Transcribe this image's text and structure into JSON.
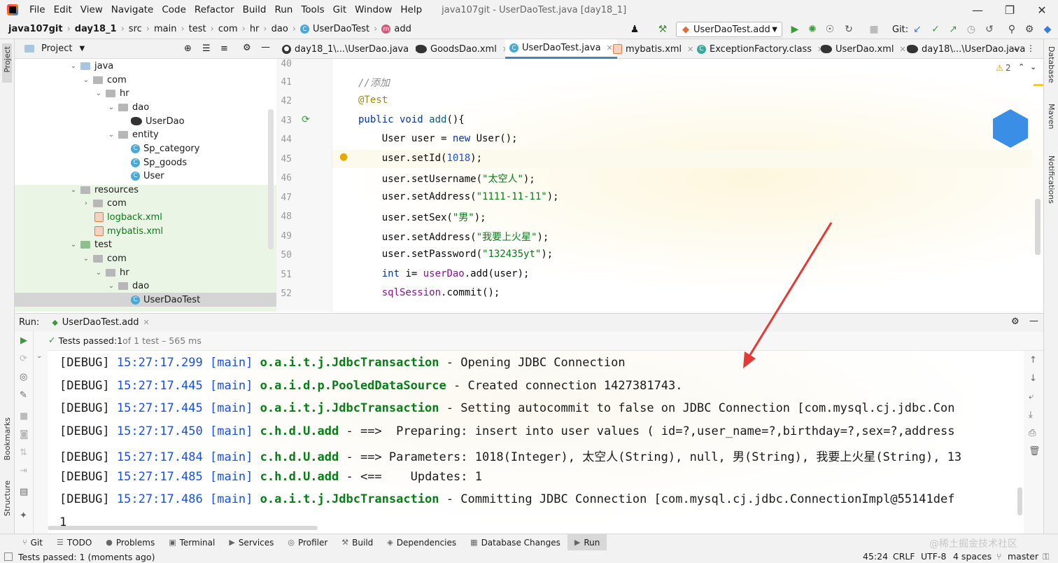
{
  "menu": {
    "items": [
      "File",
      "Edit",
      "View",
      "Navigate",
      "Code",
      "Refactor",
      "Build",
      "Run",
      "Tools",
      "Git",
      "Window",
      "Help"
    ],
    "title": "java107git - UserDaoTest.java [day18_1]"
  },
  "nav": {
    "crumbs": [
      "java107git",
      "day18_1",
      "src",
      "main",
      "test",
      "com",
      "hr",
      "dao",
      "UserDaoTest",
      "add"
    ],
    "run_config": "UserDaoTest.add",
    "git_label": "Git:"
  },
  "project": {
    "title": "Project",
    "tree": [
      {
        "label": "java",
        "level": 0,
        "type": "folder"
      },
      {
        "label": "com",
        "level": 1,
        "type": "folder"
      },
      {
        "label": "hr",
        "level": 2,
        "type": "folder"
      },
      {
        "label": "dao",
        "level": 3,
        "type": "folder"
      },
      {
        "label": "UserDao",
        "level": 4,
        "type": "bird"
      },
      {
        "label": "entity",
        "level": 3,
        "type": "folder"
      },
      {
        "label": "Sp_category",
        "level": 4,
        "type": "class"
      },
      {
        "label": "Sp_goods",
        "level": 4,
        "type": "class"
      },
      {
        "label": "User",
        "level": 4,
        "type": "class"
      },
      {
        "label": "resources",
        "level": 0,
        "type": "folder"
      },
      {
        "label": "com",
        "level": 1,
        "type": "folder"
      },
      {
        "label": "logback.xml",
        "level": 1,
        "type": "xml"
      },
      {
        "label": "mybatis.xml",
        "level": 1,
        "type": "xml"
      },
      {
        "label": "test",
        "level": 0,
        "type": "folder"
      },
      {
        "label": "com",
        "level": 1,
        "type": "folder"
      },
      {
        "label": "hr",
        "level": 2,
        "type": "folder"
      },
      {
        "label": "dao",
        "level": 3,
        "type": "folder"
      },
      {
        "label": "UserDaoTest",
        "level": 4,
        "type": "class"
      }
    ]
  },
  "tabs": [
    {
      "label": "day18_1\\...\\UserDao.java"
    },
    {
      "label": "GoodsDao.xml"
    },
    {
      "label": "UserDaoTest.java"
    },
    {
      "label": "mybatis.xml"
    },
    {
      "label": "ExceptionFactory.class"
    },
    {
      "label": "UserDao.xml"
    },
    {
      "label": "day18\\...\\UserDao.java"
    }
  ],
  "editor": {
    "warnings": "2",
    "line_numbers": [
      "40",
      "41",
      "42",
      "43",
      "44",
      "45",
      "46",
      "47",
      "48",
      "49",
      "50",
      "51",
      "52"
    ],
    "lines": {
      "l41": "//添加",
      "l42": "@Test",
      "l43a": "public void ",
      "l43b": "add",
      "l43c": "(){",
      "l44a": "    User user = ",
      "l44b": "new ",
      "l44c": "User();",
      "l45a": "    user.setId(",
      "l45b": "1018",
      "l45c": ");",
      "l46a": "    user.setUsername(",
      "l46b": "\"太空人\"",
      "l46c": ");",
      "l47a": "    user.setAddress(",
      "l47b": "\"1111-11-11\"",
      "l47c": ");",
      "l48a": "    user.setSex(",
      "l48b": "\"男\"",
      "l48c": ");",
      "l49a": "    user.setAddress(",
      "l49b": "\"我要上火星\"",
      "l49c": ");",
      "l50a": "    user.setPassword(",
      "l50b": "\"132435yt\"",
      "l50c": ");",
      "l51a": "    ",
      "l51b": "int ",
      "l51c": "i= ",
      "l51d": "userDao",
      "l51e": ".add(user);",
      "l52a": "    ",
      "l52b": "sqlSession",
      "l52c": ".commit();"
    }
  },
  "run": {
    "label": "Run:",
    "tab": "UserDaoTest.add",
    "status_passed": "Tests passed: ",
    "status_count": "1",
    "status_rest": " of 1 test – 565 ms",
    "logs": [
      {
        "level": "[DEBUG]",
        "time": "15:27:17.299",
        "thread": "[main]",
        "logger": "o.a.i.t.j.JdbcTransaction",
        "msg": " - Opening JDBC Connection"
      },
      {
        "level": "[DEBUG]",
        "time": "15:27:17.445",
        "thread": "[main]",
        "logger": "o.a.i.d.p.PooledDataSource",
        "msg": " - Created connection 1427381743."
      },
      {
        "level": "[DEBUG]",
        "time": "15:27:17.445",
        "thread": "[main]",
        "logger": "o.a.i.t.j.JdbcTransaction",
        "msg": " - Setting autocommit to false on JDBC Connection [com.mysql.cj.jdbc.Con"
      },
      {
        "level": "[DEBUG]",
        "time": "15:27:17.450",
        "thread": "[main]",
        "logger": "c.h.d.U.add",
        "msg": " - ==>  Preparing: insert into user values ( id=?,user_name=?,birthday=?,sex=?,address"
      },
      {
        "level": "[DEBUG]",
        "time": "15:27:17.484",
        "thread": "[main]",
        "logger": "c.h.d.U.add",
        "msg": " - ==> Parameters: 1018(Integer), 太空人(String), null, 男(String), 我要上火星(String), 13"
      },
      {
        "level": "[DEBUG]",
        "time": "15:27:17.485",
        "thread": "[main]",
        "logger": "c.h.d.U.add",
        "msg": " - <==    Updates: 1"
      },
      {
        "level": "[DEBUG]",
        "time": "15:27:17.486",
        "thread": "[main]",
        "logger": "o.a.i.t.j.JdbcTransaction",
        "msg": " - Committing JDBC Connection [com.mysql.cj.jdbc.ConnectionImpl@55141def"
      }
    ],
    "last_line": "1"
  },
  "bottom_tabs": [
    "Git",
    "TODO",
    "Problems",
    "Terminal",
    "Services",
    "Profiler",
    "Build",
    "Dependencies",
    "Database Changes",
    "Run"
  ],
  "side": {
    "left": [
      "Project",
      "Bookmarks",
      "Structure"
    ],
    "right": [
      "Database",
      "Maven",
      "Notifications"
    ]
  },
  "status": {
    "message": "Tests passed: 1 (moments ago)",
    "position": "45:24",
    "line_sep": "CRLF",
    "encoding": "UTF-8",
    "indent": "4 spaces",
    "branch": "master",
    "watermark": "@稀土掘金技术社区"
  },
  "colors": {
    "accent": "#4083c9",
    "log_time": "#1750eb",
    "log_logger": "#067d17",
    "arrow": "#e53935"
  }
}
